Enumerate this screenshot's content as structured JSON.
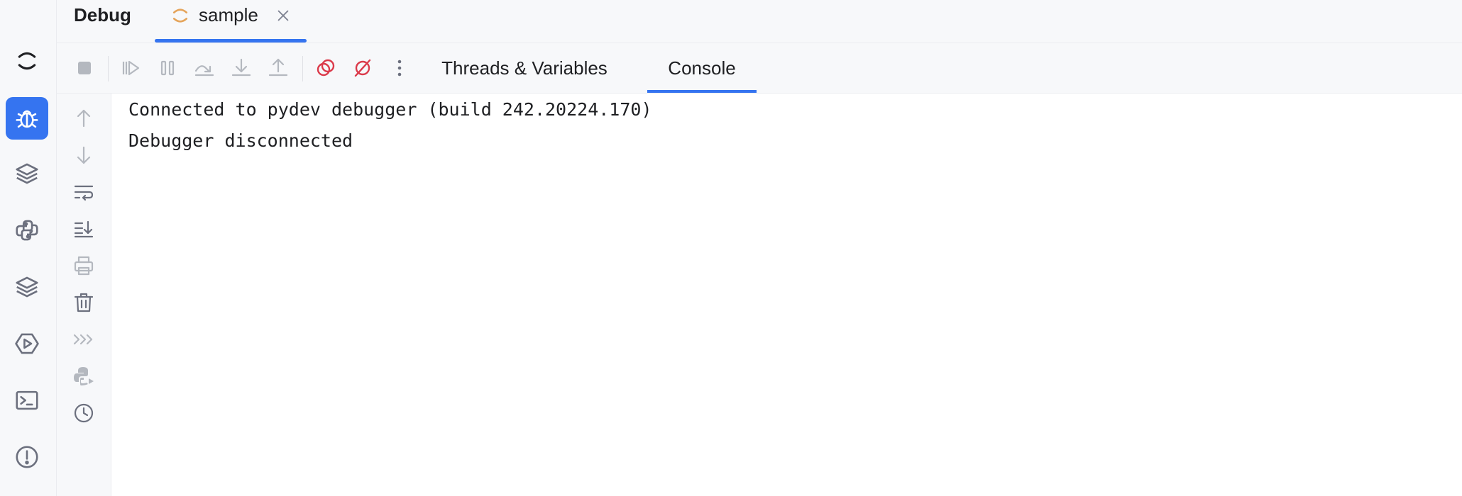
{
  "header": {
    "panel_title": "Debug",
    "session_tab": {
      "label": "sample"
    }
  },
  "toolbar": {
    "tabs": [
      {
        "label": "Threads & Variables",
        "selected": false
      },
      {
        "label": "Console",
        "selected": true
      }
    ]
  },
  "console": {
    "lines": [
      "Connected to pydev debugger (build 242.20224.170)",
      "Debugger disconnected"
    ]
  },
  "colors": {
    "accent": "#3574f0",
    "breakpoint_red": "#db3b4b",
    "running_orange": "#e5a45a",
    "icon_gray": "#6c707e",
    "icon_disabled": "#b4b8bf"
  },
  "icons": {
    "toolstrip": [
      "loading-icon",
      "debug-bug-icon",
      "layers-icon",
      "python-icon",
      "layers-icon",
      "run-services-icon",
      "terminal-icon",
      "problems-icon"
    ],
    "debug_toolbar": [
      "stop-icon",
      "resume-icon",
      "pause-icon",
      "step-over-icon",
      "step-into-icon",
      "step-out-icon",
      "view-breakpoints-icon",
      "mute-breakpoints-icon",
      "more-icon"
    ],
    "console_side": [
      "arrow-up-icon",
      "arrow-down-icon",
      "soft-wrap-icon",
      "scroll-to-end-icon",
      "print-icon",
      "trash-icon",
      "prompt-icon",
      "python-console-icon",
      "history-icon"
    ]
  }
}
